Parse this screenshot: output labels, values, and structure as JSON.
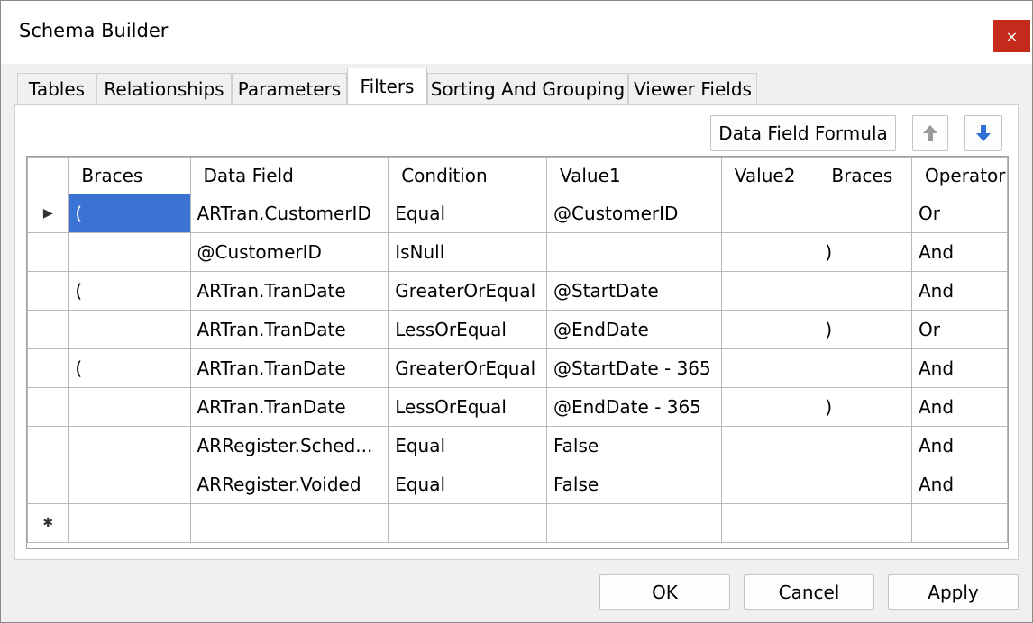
{
  "window": {
    "title": "Schema Builder",
    "close_label": "×"
  },
  "tabs": [
    {
      "label": "Tables"
    },
    {
      "label": "Relationships"
    },
    {
      "label": "Parameters"
    },
    {
      "label": "Filters"
    },
    {
      "label": "Sorting And Grouping"
    },
    {
      "label": "Viewer Fields"
    }
  ],
  "active_tab": "Filters",
  "toolbar": {
    "formula_label": "Data Field Formula",
    "up_icon": "arrow-up-icon",
    "down_icon": "arrow-down-icon"
  },
  "grid": {
    "columns": [
      "Braces",
      "Data Field",
      "Condition",
      "Value1",
      "Value2",
      "Braces",
      "Operator"
    ],
    "rows": [
      [
        "(",
        "ARTran.CustomerID",
        "Equal",
        "@CustomerID",
        "",
        "",
        "Or"
      ],
      [
        "",
        "@CustomerID",
        "IsNull",
        "",
        "",
        ")",
        "And"
      ],
      [
        "(",
        "ARTran.TranDate",
        "GreaterOrEqual",
        "@StartDate",
        "",
        "",
        "And"
      ],
      [
        "",
        "ARTran.TranDate",
        "LessOrEqual",
        "@EndDate",
        "",
        ")",
        "Or"
      ],
      [
        "(",
        "ARTran.TranDate",
        "GreaterOrEqual",
        "@StartDate - 365",
        "",
        "",
        "And"
      ],
      [
        "",
        "ARTran.TranDate",
        "LessOrEqual",
        "@EndDate - 365",
        "",
        ")",
        "And"
      ],
      [
        "",
        "ARRegister.Sched...",
        "Equal",
        "False",
        "",
        "",
        "And"
      ],
      [
        "",
        "ARRegister.Voided",
        "Equal",
        "False",
        "",
        "",
        "And"
      ]
    ],
    "current_row_marker": "▶",
    "new_row_marker": "✱"
  },
  "footer": {
    "ok_label": "OK",
    "cancel_label": "Cancel",
    "apply_label": "Apply"
  },
  "colors": {
    "selection": "#3b73d4",
    "close_button": "#c42b1c",
    "arrow_up": "#9a9a9a",
    "arrow_down": "#2f6fd6"
  }
}
